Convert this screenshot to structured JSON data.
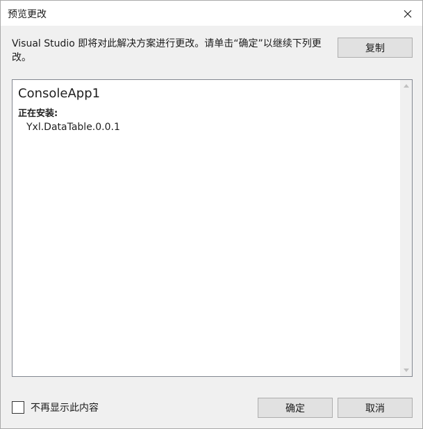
{
  "window": {
    "title": "预览更改"
  },
  "description": "Visual Studio 即将对此解决方案进行更改。请单击“确定”以继续下列更改。",
  "buttons": {
    "copy": "复制",
    "ok": "确定",
    "cancel": "取消"
  },
  "changes": {
    "project": "ConsoleApp1",
    "section": "正在安装:",
    "packages": [
      "Yxl.DataTable.0.0.1"
    ]
  },
  "dont_show": {
    "label": "不再显示此内容",
    "checked": false
  },
  "icons": {
    "close": "close-icon",
    "scroll_up": "scroll-up-icon",
    "scroll_down": "scroll-down-icon"
  }
}
